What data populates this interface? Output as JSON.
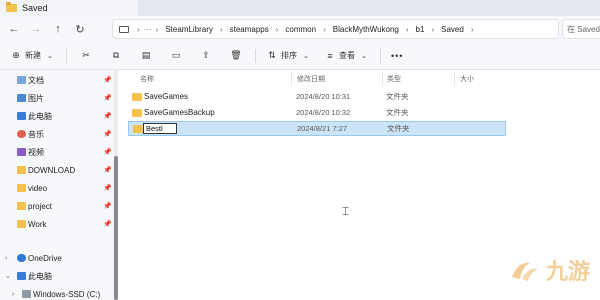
{
  "window": {
    "tab_title": "Saved"
  },
  "nav": {
    "back_icon": "arrow-left-icon",
    "forward_icon": "arrow-right-icon",
    "up_icon": "arrow-up-icon",
    "refresh_icon": "refresh-icon",
    "breadcrumbs": [
      "SteamLibrary",
      "steamapps",
      "common",
      "BlackMythWukong",
      "b1",
      "Saved"
    ],
    "search_placeholder": "在 Saved 中"
  },
  "toolbar": {
    "new_label": "新建",
    "sort_label": "排序",
    "view_label": "查看",
    "more_label": "•••"
  },
  "sidebar": {
    "items": [
      {
        "label": "文档",
        "icon": "document-icon",
        "pinned": true
      },
      {
        "label": "图片",
        "icon": "picture-icon",
        "pinned": true
      },
      {
        "label": "此电脑",
        "icon": "computer-icon",
        "pinned": true
      },
      {
        "label": "音乐",
        "icon": "music-icon",
        "pinned": true
      },
      {
        "label": "视频",
        "icon": "video-icon",
        "pinned": true
      },
      {
        "label": "DOWNLOAD",
        "icon": "folder-icon",
        "pinned": true
      },
      {
        "label": "video",
        "icon": "folder-icon",
        "pinned": true
      },
      {
        "label": "project",
        "icon": "folder-icon",
        "pinned": true
      },
      {
        "label": "Work",
        "icon": "folder-icon",
        "pinned": true
      },
      {
        "label": "OneDrive",
        "icon": "cloud-icon",
        "pinned": false
      },
      {
        "label": "此电脑",
        "icon": "computer-icon",
        "pinned": false
      },
      {
        "label": "Windows-SSD (C:)",
        "icon": "drive-icon",
        "pinned": false
      }
    ]
  },
  "columns": {
    "name": "名称",
    "date": "修改日期",
    "type": "类型",
    "size": "大小"
  },
  "files": [
    {
      "name": "SaveGames",
      "date": "2024/8/20 10:31",
      "type": "文件夹"
    },
    {
      "name": "SaveGamesBackup",
      "date": "2024/8/20 10:32",
      "type": "文件夹"
    },
    {
      "name": "Bestl",
      "date": "2024/8/21 7:27",
      "type": "文件夹",
      "renaming": true
    }
  ],
  "watermark": {
    "text": "九游"
  },
  "colors": {
    "selection": "#cce4f7",
    "folder": "#f2c14e",
    "sidebar_bg": "#f7f8fb"
  }
}
